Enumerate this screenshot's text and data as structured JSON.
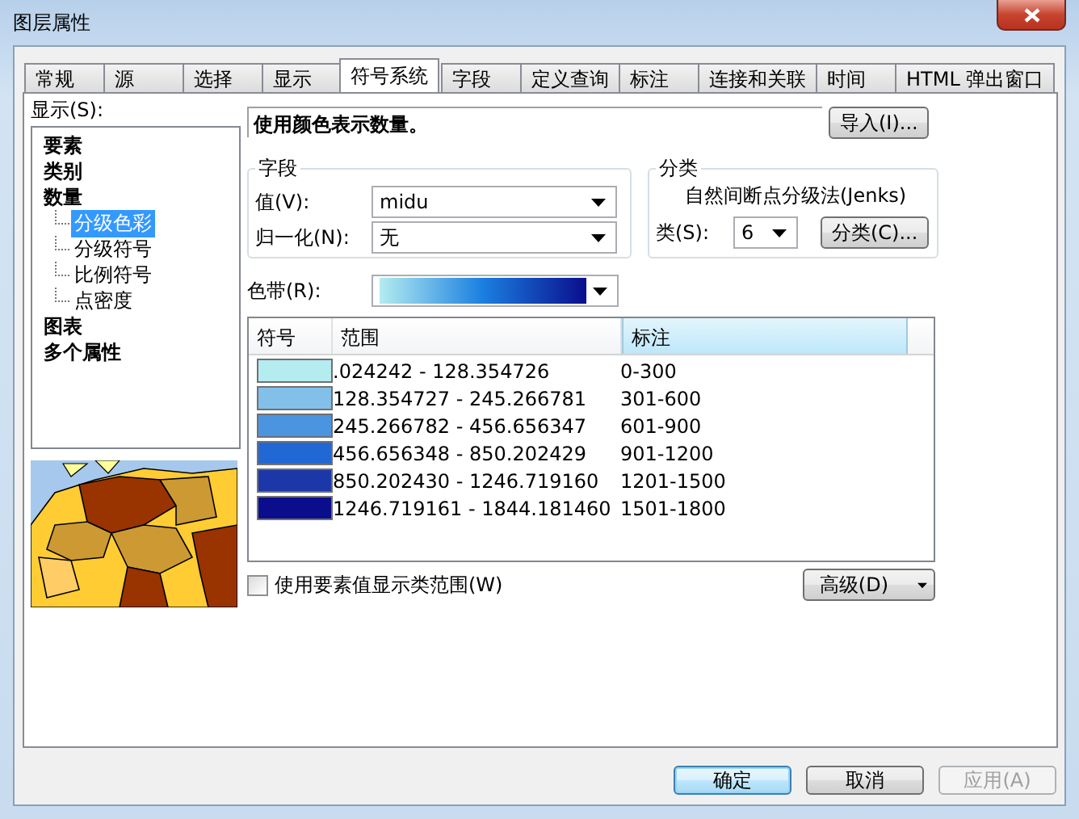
{
  "window": {
    "title": "图层属性"
  },
  "tabs": [
    {
      "label": "常规",
      "selected": false
    },
    {
      "label": "源",
      "selected": false
    },
    {
      "label": "选择",
      "selected": false
    },
    {
      "label": "显示",
      "selected": false
    },
    {
      "label": "符号系统",
      "selected": true
    },
    {
      "label": "字段",
      "selected": false
    },
    {
      "label": "定义查询",
      "selected": false
    },
    {
      "label": "标注",
      "selected": false
    },
    {
      "label": "连接和关联",
      "selected": false
    },
    {
      "label": "时间",
      "selected": false
    },
    {
      "label": "HTML 弹出窗口",
      "selected": false
    }
  ],
  "show_label": "显示(S):",
  "tree": [
    {
      "label": "要素",
      "selected": false
    },
    {
      "label": "类别",
      "selected": false
    },
    {
      "label": "数量",
      "selected": false,
      "children": [
        {
          "label": "分级色彩",
          "selected": true
        },
        {
          "label": "分级符号",
          "selected": false
        },
        {
          "label": "比例符号",
          "selected": false
        },
        {
          "label": "点密度",
          "selected": false
        }
      ]
    },
    {
      "label": "图表",
      "selected": false
    },
    {
      "label": "多个属性",
      "selected": false
    }
  ],
  "description": "使用颜色表示数量。",
  "import_button": "导入(I)...",
  "field_group": {
    "title": "字段",
    "value_label": "值(V):",
    "value": "midu",
    "normalize_label": "归一化(N):",
    "normalize": "无"
  },
  "classification": {
    "title": "分类",
    "method": "自然间断点分级法(Jenks)",
    "classes_label": "类(S):",
    "classes": "6",
    "classify_button": "分类(C)..."
  },
  "color_ramp_label": "色带(R):",
  "table": {
    "columns": [
      {
        "label": "符号",
        "hovered": false
      },
      {
        "label": "范围",
        "hovered": false
      },
      {
        "label": "标注",
        "hovered": true
      }
    ],
    "rows": [
      {
        "color": "#b4ecf0",
        "range": ".024242 - 128.354726",
        "label": "0-300"
      },
      {
        "color": "#82c0ea",
        "range": "128.354727 - 245.266781",
        "label": "301-600"
      },
      {
        "color": "#4a94e0",
        "range": "245.266782 - 456.656347",
        "label": "601-900"
      },
      {
        "color": "#2268d4",
        "range": "456.656348 - 850.202429",
        "label": "901-1200"
      },
      {
        "color": "#1c38a8",
        "range": "850.202430 - 1246.719160",
        "label": "1201-1500"
      },
      {
        "color": "#0a0e8c",
        "range": "1246.719161 - 1844.181460",
        "label": "1501-1800"
      }
    ]
  },
  "use_feature_values": {
    "label": "使用要素值显示类范围(W)",
    "checked": false
  },
  "advanced_button": "高级(D)",
  "buttons": [
    {
      "label": "确定",
      "kind": "default"
    },
    {
      "label": "取消",
      "kind": "normal"
    },
    {
      "label": "应用(A)",
      "kind": "disabled"
    }
  ]
}
